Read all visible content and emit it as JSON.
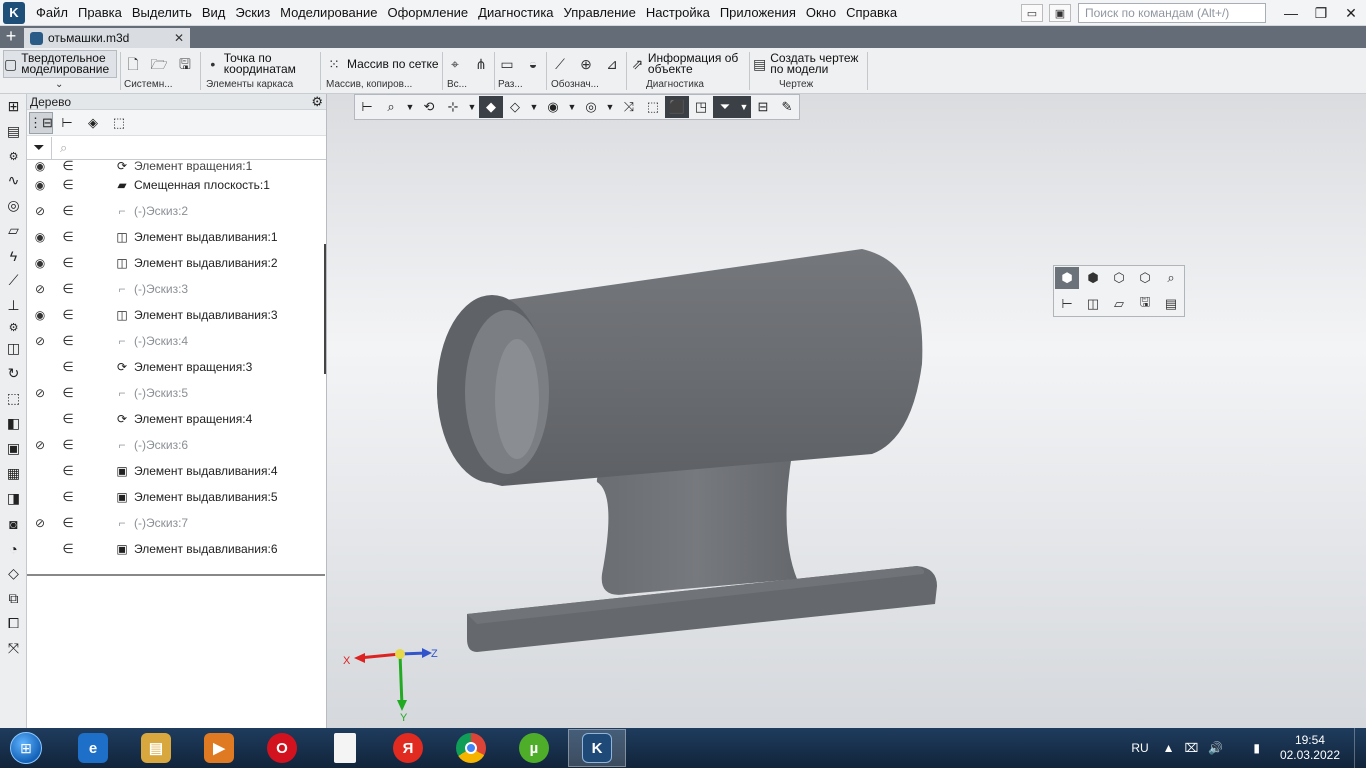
{
  "menu": [
    "Файл",
    "Правка",
    "Выделить",
    "Вид",
    "Эскиз",
    "Моделирование",
    "Оформление",
    "Диагностика",
    "Управление",
    "Настройка",
    "Приложения",
    "Окно",
    "Справка"
  ],
  "search_placeholder": "Поиск по командам (Alt+/)",
  "tab": {
    "title": "отьмашки.m3d"
  },
  "ribbon": {
    "mode_label": "Твердотельное моделирование",
    "point_label": "Точка по координатам",
    "array_label": "Массив по сетке",
    "info_label": "Информация об объекте",
    "drawing_label": "Создать чертеж по модели",
    "groups": [
      "Системн...",
      "Элементы каркаса",
      "Массив, копиров...",
      "Вс...",
      "Раз...",
      "Обознач...",
      "Диагностика",
      "Чертеж"
    ]
  },
  "tree": {
    "title": "Дерево",
    "rows": [
      {
        "label": "Элемент вращения:1",
        "kind": "revolve",
        "visible": true,
        "top": true
      },
      {
        "label": "Смещенная плоскость:1",
        "kind": "plane",
        "visible": true
      },
      {
        "label": "(-)Эскиз:2",
        "kind": "sketch",
        "visible": false
      },
      {
        "label": "Элемент выдавливания:1",
        "kind": "extrude",
        "visible": true
      },
      {
        "label": "Элемент выдавливания:2",
        "kind": "extrude",
        "visible": true
      },
      {
        "label": "(-)Эскиз:3",
        "kind": "sketch",
        "visible": false
      },
      {
        "label": "Элемент выдавливания:3",
        "kind": "extrude",
        "visible": true
      },
      {
        "label": "(-)Эскиз:4",
        "kind": "sketch",
        "visible": false
      },
      {
        "label": "Элемент вращения:3",
        "kind": "revolve",
        "visible": null
      },
      {
        "label": "(-)Эскиз:5",
        "kind": "sketch",
        "visible": false
      },
      {
        "label": "Элемент вращения:4",
        "kind": "revolve",
        "visible": null
      },
      {
        "label": "(-)Эскиз:6",
        "kind": "sketch",
        "visible": false
      },
      {
        "label": "Элемент выдавливания:4",
        "kind": "cut",
        "visible": null
      },
      {
        "label": "Элемент выдавливания:5",
        "kind": "cut",
        "visible": null
      },
      {
        "label": "(-)Эскиз:7",
        "kind": "sketch",
        "visible": false
      },
      {
        "label": "Элемент выдавливания:6",
        "kind": "cut",
        "visible": null
      }
    ]
  },
  "axes": {
    "x": "X",
    "y": "Y",
    "z": "Z"
  },
  "taskbar": {
    "lang": "RU",
    "time": "19:54",
    "date": "02.03.2022"
  },
  "colors": {
    "model": "#6a6d71",
    "taskbar": "#1a3350",
    "active_toggle": "#3b4046"
  }
}
